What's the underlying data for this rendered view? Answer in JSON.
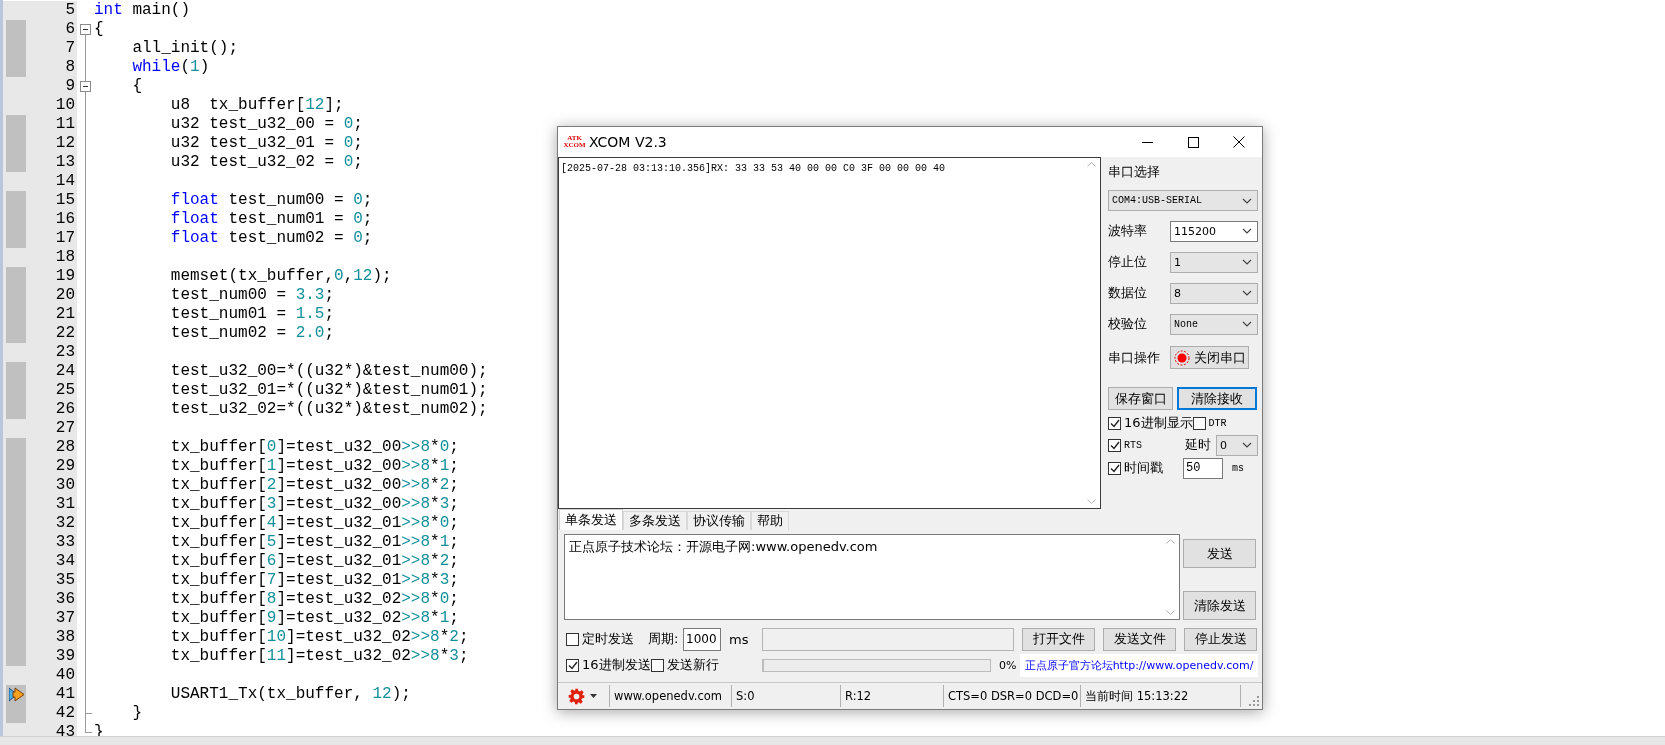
{
  "editor": {
    "lines": [
      {
        "number": "5",
        "covered": false,
        "current": false,
        "fold_marker": false,
        "fold_end": false,
        "code": [
          {
            "kind": "keyword",
            "text": "int"
          },
          {
            "kind": "plain",
            "text": " main()"
          }
        ]
      },
      {
        "number": "6",
        "covered": true,
        "current": false,
        "fold_marker": true,
        "fold_end": false,
        "code": [
          {
            "kind": "plain",
            "text": "{"
          }
        ]
      },
      {
        "number": "7",
        "covered": true,
        "current": false,
        "fold_marker": false,
        "fold_end": false,
        "code": [
          {
            "kind": "plain",
            "text": "    all_init();"
          }
        ]
      },
      {
        "number": "8",
        "covered": true,
        "current": false,
        "fold_marker": false,
        "fold_end": false,
        "code": [
          {
            "kind": "keyword",
            "text": "    while"
          },
          {
            "kind": "plain",
            "text": "("
          },
          {
            "kind": "number",
            "text": "1"
          },
          {
            "kind": "plain",
            "text": ")"
          }
        ]
      },
      {
        "number": "9",
        "covered": false,
        "current": false,
        "fold_marker": true,
        "fold_end": false,
        "code": [
          {
            "kind": "plain",
            "text": "    {"
          }
        ]
      },
      {
        "number": "10",
        "covered": false,
        "current": false,
        "fold_marker": false,
        "fold_end": false,
        "code": [
          {
            "kind": "plain",
            "text": "        u8  tx_buffer["
          },
          {
            "kind": "number",
            "text": "12"
          },
          {
            "kind": "plain",
            "text": "];"
          }
        ]
      },
      {
        "number": "11",
        "covered": true,
        "current": false,
        "fold_marker": false,
        "fold_end": false,
        "code": [
          {
            "kind": "plain",
            "text": "        u32 test_u32_00 = "
          },
          {
            "kind": "number",
            "text": "0"
          },
          {
            "kind": "plain",
            "text": ";"
          }
        ]
      },
      {
        "number": "12",
        "covered": true,
        "current": false,
        "fold_marker": false,
        "fold_end": false,
        "code": [
          {
            "kind": "plain",
            "text": "        u32 test_u32_01 = "
          },
          {
            "kind": "number",
            "text": "0"
          },
          {
            "kind": "plain",
            "text": ";"
          }
        ]
      },
      {
        "number": "13",
        "covered": true,
        "current": false,
        "fold_marker": false,
        "fold_end": false,
        "code": [
          {
            "kind": "plain",
            "text": "        u32 test_u32_02 = "
          },
          {
            "kind": "number",
            "text": "0"
          },
          {
            "kind": "plain",
            "text": ";"
          }
        ]
      },
      {
        "number": "14",
        "covered": false,
        "current": false,
        "fold_marker": false,
        "fold_end": false
      },
      {
        "number": "15",
        "covered": true,
        "current": false,
        "fold_marker": false,
        "fold_end": false,
        "code": [
          {
            "kind": "keyword",
            "text": "        float"
          },
          {
            "kind": "plain",
            "text": " test_num00 = "
          },
          {
            "kind": "number",
            "text": "0"
          },
          {
            "kind": "plain",
            "text": ";"
          }
        ]
      },
      {
        "number": "16",
        "covered": true,
        "current": false,
        "fold_marker": false,
        "fold_end": false,
        "code": [
          {
            "kind": "keyword",
            "text": "        float"
          },
          {
            "kind": "plain",
            "text": " test_num01 = "
          },
          {
            "kind": "number",
            "text": "0"
          },
          {
            "kind": "plain",
            "text": ";"
          }
        ]
      },
      {
        "number": "17",
        "covered": true,
        "current": false,
        "fold_marker": false,
        "fold_end": false,
        "code": [
          {
            "kind": "keyword",
            "text": "        float"
          },
          {
            "kind": "plain",
            "text": " test_num02 = "
          },
          {
            "kind": "number",
            "text": "0"
          },
          {
            "kind": "plain",
            "text": ";"
          }
        ]
      },
      {
        "number": "18",
        "covered": false,
        "current": false,
        "fold_marker": false,
        "fold_end": false
      },
      {
        "number": "19",
        "covered": true,
        "current": false,
        "fold_marker": false,
        "fold_end": false,
        "code": [
          {
            "kind": "plain",
            "text": "        memset(tx_buffer,"
          },
          {
            "kind": "number",
            "text": "0"
          },
          {
            "kind": "plain",
            "text": ","
          },
          {
            "kind": "number",
            "text": "12"
          },
          {
            "kind": "plain",
            "text": ");"
          }
        ]
      },
      {
        "number": "20",
        "covered": true,
        "current": false,
        "fold_marker": false,
        "fold_end": false,
        "code": [
          {
            "kind": "plain",
            "text": "        test_num00 = "
          },
          {
            "kind": "number",
            "text": "3.3"
          },
          {
            "kind": "plain",
            "text": ";"
          }
        ]
      },
      {
        "number": "21",
        "covered": true,
        "current": false,
        "fold_marker": false,
        "fold_end": false,
        "code": [
          {
            "kind": "plain",
            "text": "        test_num01 = "
          },
          {
            "kind": "number",
            "text": "1.5"
          },
          {
            "kind": "plain",
            "text": ";"
          }
        ]
      },
      {
        "number": "22",
        "covered": true,
        "current": false,
        "fold_marker": false,
        "fold_end": false,
        "code": [
          {
            "kind": "plain",
            "text": "        test_num02 = "
          },
          {
            "kind": "number",
            "text": "2.0"
          },
          {
            "kind": "plain",
            "text": ";"
          }
        ]
      },
      {
        "number": "23",
        "covered": false,
        "current": false,
        "fold_marker": false,
        "fold_end": false
      },
      {
        "number": "24",
        "covered": true,
        "current": false,
        "fold_marker": false,
        "fold_end": false,
        "code": [
          {
            "kind": "plain",
            "text": "        test_u32_00=*((u32*)&test_num00);"
          }
        ]
      },
      {
        "number": "25",
        "covered": true,
        "current": false,
        "fold_marker": false,
        "fold_end": false,
        "code": [
          {
            "kind": "plain",
            "text": "        test_u32_01=*((u32*)&test_num01);"
          }
        ]
      },
      {
        "number": "26",
        "covered": true,
        "current": false,
        "fold_marker": false,
        "fold_end": false,
        "code": [
          {
            "kind": "plain",
            "text": "        test_u32_02=*((u32*)&test_num02);"
          }
        ]
      },
      {
        "number": "27",
        "covered": false,
        "current": false,
        "fold_marker": false,
        "fold_end": false
      },
      {
        "number": "28",
        "covered": true,
        "current": false,
        "fold_marker": false,
        "fold_end": false,
        "code": [
          {
            "kind": "plain",
            "text": "        tx_buffer["
          },
          {
            "kind": "number",
            "text": "0"
          },
          {
            "kind": "plain",
            "text": "]=test_u32_00"
          },
          {
            "kind": "number",
            "text": ">>8"
          },
          {
            "kind": "plain",
            "text": "*"
          },
          {
            "kind": "number",
            "text": "0"
          },
          {
            "kind": "plain",
            "text": ";"
          }
        ]
      },
      {
        "number": "29",
        "covered": true,
        "current": false,
        "fold_marker": false,
        "fold_end": false,
        "code": [
          {
            "kind": "plain",
            "text": "        tx_buffer["
          },
          {
            "kind": "number",
            "text": "1"
          },
          {
            "kind": "plain",
            "text": "]=test_u32_00"
          },
          {
            "kind": "number",
            "text": ">>8"
          },
          {
            "kind": "plain",
            "text": "*"
          },
          {
            "kind": "number",
            "text": "1"
          },
          {
            "kind": "plain",
            "text": ";"
          }
        ]
      },
      {
        "number": "30",
        "covered": true,
        "current": false,
        "fold_marker": false,
        "fold_end": false,
        "code": [
          {
            "kind": "plain",
            "text": "        tx_buffer["
          },
          {
            "kind": "number",
            "text": "2"
          },
          {
            "kind": "plain",
            "text": "]=test_u32_00"
          },
          {
            "kind": "number",
            "text": ">>8"
          },
          {
            "kind": "plain",
            "text": "*"
          },
          {
            "kind": "number",
            "text": "2"
          },
          {
            "kind": "plain",
            "text": ";"
          }
        ]
      },
      {
        "number": "31",
        "covered": true,
        "current": false,
        "fold_marker": false,
        "fold_end": false,
        "code": [
          {
            "kind": "plain",
            "text": "        tx_buffer["
          },
          {
            "kind": "number",
            "text": "3"
          },
          {
            "kind": "plain",
            "text": "]=test_u32_00"
          },
          {
            "kind": "number",
            "text": ">>8"
          },
          {
            "kind": "plain",
            "text": "*"
          },
          {
            "kind": "number",
            "text": "3"
          },
          {
            "kind": "plain",
            "text": ";"
          }
        ]
      },
      {
        "number": "32",
        "covered": true,
        "current": false,
        "fold_marker": false,
        "fold_end": false,
        "code": [
          {
            "kind": "plain",
            "text": "        tx_buffer["
          },
          {
            "kind": "number",
            "text": "4"
          },
          {
            "kind": "plain",
            "text": "]=test_u32_01"
          },
          {
            "kind": "number",
            "text": ">>8"
          },
          {
            "kind": "plain",
            "text": "*"
          },
          {
            "kind": "number",
            "text": "0"
          },
          {
            "kind": "plain",
            "text": ";"
          }
        ]
      },
      {
        "number": "33",
        "covered": true,
        "current": false,
        "fold_marker": false,
        "fold_end": false,
        "code": [
          {
            "kind": "plain",
            "text": "        tx_buffer["
          },
          {
            "kind": "number",
            "text": "5"
          },
          {
            "kind": "plain",
            "text": "]=test_u32_01"
          },
          {
            "kind": "number",
            "text": ">>8"
          },
          {
            "kind": "plain",
            "text": "*"
          },
          {
            "kind": "number",
            "text": "1"
          },
          {
            "kind": "plain",
            "text": ";"
          }
        ]
      },
      {
        "number": "34",
        "covered": true,
        "current": false,
        "fold_marker": false,
        "fold_end": false,
        "code": [
          {
            "kind": "plain",
            "text": "        tx_buffer["
          },
          {
            "kind": "number",
            "text": "6"
          },
          {
            "kind": "plain",
            "text": "]=test_u32_01"
          },
          {
            "kind": "number",
            "text": ">>8"
          },
          {
            "kind": "plain",
            "text": "*"
          },
          {
            "kind": "number",
            "text": "2"
          },
          {
            "kind": "plain",
            "text": ";"
          }
        ]
      },
      {
        "number": "35",
        "covered": true,
        "current": false,
        "fold_marker": false,
        "fold_end": false,
        "code": [
          {
            "kind": "plain",
            "text": "        tx_buffer["
          },
          {
            "kind": "number",
            "text": "7"
          },
          {
            "kind": "plain",
            "text": "]=test_u32_01"
          },
          {
            "kind": "number",
            "text": ">>8"
          },
          {
            "kind": "plain",
            "text": "*"
          },
          {
            "kind": "number",
            "text": "3"
          },
          {
            "kind": "plain",
            "text": ";"
          }
        ]
      },
      {
        "number": "36",
        "covered": true,
        "current": false,
        "fold_marker": false,
        "fold_end": false,
        "code": [
          {
            "kind": "plain",
            "text": "        tx_buffer["
          },
          {
            "kind": "number",
            "text": "8"
          },
          {
            "kind": "plain",
            "text": "]=test_u32_02"
          },
          {
            "kind": "number",
            "text": ">>8"
          },
          {
            "kind": "plain",
            "text": "*"
          },
          {
            "kind": "number",
            "text": "0"
          },
          {
            "kind": "plain",
            "text": ";"
          }
        ]
      },
      {
        "number": "37",
        "covered": true,
        "current": false,
        "fold_marker": false,
        "fold_end": false,
        "code": [
          {
            "kind": "plain",
            "text": "        tx_buffer["
          },
          {
            "kind": "number",
            "text": "9"
          },
          {
            "kind": "plain",
            "text": "]=test_u32_02"
          },
          {
            "kind": "number",
            "text": ">>8"
          },
          {
            "kind": "plain",
            "text": "*"
          },
          {
            "kind": "number",
            "text": "1"
          },
          {
            "kind": "plain",
            "text": ";"
          }
        ]
      },
      {
        "number": "38",
        "covered": true,
        "current": false,
        "fold_marker": false,
        "fold_end": false,
        "code": [
          {
            "kind": "plain",
            "text": "        tx_buffer["
          },
          {
            "kind": "number",
            "text": "10"
          },
          {
            "kind": "plain",
            "text": "]=test_u32_02"
          },
          {
            "kind": "number",
            "text": ">>8"
          },
          {
            "kind": "plain",
            "text": "*"
          },
          {
            "kind": "number",
            "text": "2"
          },
          {
            "kind": "plain",
            "text": ";"
          }
        ]
      },
      {
        "number": "39",
        "covered": true,
        "current": false,
        "fold_marker": false,
        "fold_end": false,
        "code": [
          {
            "kind": "plain",
            "text": "        tx_buffer["
          },
          {
            "kind": "number",
            "text": "11"
          },
          {
            "kind": "plain",
            "text": "]=test_u32_02"
          },
          {
            "kind": "number",
            "text": ">>8"
          },
          {
            "kind": "plain",
            "text": "*"
          },
          {
            "kind": "number",
            "text": "3"
          },
          {
            "kind": "plain",
            "text": ";"
          }
        ]
      },
      {
        "number": "40",
        "covered": false,
        "current": false,
        "fold_marker": false,
        "fold_end": false
      },
      {
        "number": "41",
        "covered": true,
        "current": true,
        "fold_marker": false,
        "fold_end": false,
        "code": [
          {
            "kind": "plain",
            "text": "        USART1_Tx(tx_buffer, "
          },
          {
            "kind": "number",
            "text": "12"
          },
          {
            "kind": "plain",
            "text": ");"
          }
        ]
      },
      {
        "number": "42",
        "covered": true,
        "current": false,
        "fold_marker": false,
        "fold_end": true,
        "code": [
          {
            "kind": "plain",
            "text": "    }"
          }
        ]
      },
      {
        "number": "43",
        "covered": false,
        "current": false,
        "fold_marker": false,
        "fold_end": true,
        "code": [
          {
            "kind": "plain",
            "text": "}"
          }
        ]
      }
    ]
  },
  "serial_tool": {
    "title": "XCOM V2.3",
    "logo_text": [
      "ATK",
      "XCOM"
    ],
    "receive_text": "[2025-07-28 03:13:10.356]RX: 33 33 53 40 00 00 C0 3F 00 00 00 40",
    "port": {
      "label": "串口选择",
      "value": "COM4:USB-SERIAL"
    },
    "settings": [
      {
        "label": "波特率",
        "value": "115200",
        "kind": "editable"
      },
      {
        "label": "停止位",
        "value": "1",
        "kind": "dropdown"
      },
      {
        "label": "数据位",
        "value": "8",
        "kind": "dropdown"
      },
      {
        "label": "校验位",
        "value": "None",
        "kind": "dropdown"
      }
    ],
    "port_action": {
      "label": "串口操作",
      "button": "关闭串口",
      "open": true
    },
    "receive_buttons": [
      {
        "label": "保存窗口",
        "focused": false
      },
      {
        "label": "清除接收",
        "focused": true
      }
    ],
    "hex_display": {
      "label": "16进制显示",
      "checked": true
    },
    "dtr": {
      "label": "DTR",
      "checked": false
    },
    "rts": {
      "label": "RTS",
      "checked": true
    },
    "delay": {
      "label": "延时",
      "value": "0"
    },
    "timestamp": {
      "label": "时间戳",
      "checked": true
    },
    "timestamp_interval": {
      "value": "50",
      "unit": "ms"
    },
    "send_tabs": [
      {
        "label": "单条发送",
        "selected": true
      },
      {
        "label": "多条发送",
        "selected": false
      },
      {
        "label": "协议传输",
        "selected": false
      },
      {
        "label": "帮助",
        "selected": false
      }
    ],
    "send_text": "正点原子技术论坛：开源电子网:www.openedv.com",
    "send_buttons": [
      "发送",
      "清除发送"
    ],
    "timed_send": {
      "label": "定时发送",
      "checked": false
    },
    "period": {
      "label": "周期:",
      "value": "1000",
      "unit": "ms"
    },
    "file_buttons": [
      "打开文件",
      "发送文件",
      "停止发送"
    ],
    "hex_send": {
      "label": "16进制发送",
      "checked": true
    },
    "send_newline": {
      "label": "发送新行",
      "checked": false
    },
    "progress": {
      "level": 0,
      "reading": "0%"
    },
    "forum_link": "正点原子官方论坛http://www.openedv.com/",
    "status_bar": {
      "website": "www.openedv.com",
      "sent": "S:0",
      "received": "R:12",
      "signals": "CTS=0 DSR=0 DCD=0",
      "clock": "当前时间 15:13:22"
    }
  }
}
